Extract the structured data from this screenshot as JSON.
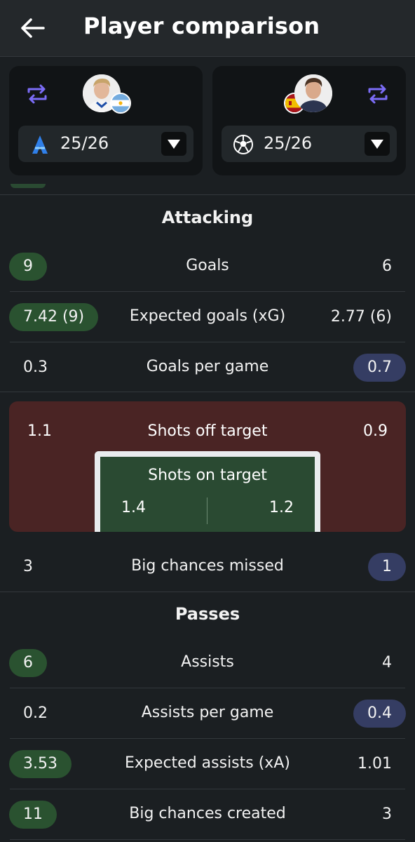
{
  "header": {
    "title": "Player comparison",
    "back_icon": "arrow-left-icon"
  },
  "players": [
    {
      "side": "left",
      "nationality_flag": "argentina-flag-icon",
      "competition_icon": "serie-a-icon",
      "season": "25/26",
      "swap_icon": "swap-icon"
    },
    {
      "side": "right",
      "nationality_flag": "spain-flag-icon",
      "competition_icon": "champions-league-icon",
      "season": "25/26",
      "swap_icon": "swap-icon"
    }
  ],
  "colors": {
    "better_left": "#2a5230",
    "better_right": "#353d63",
    "accent": "#7b6cf6",
    "shots_bg": "#4a2424",
    "goal_bg": "#2a4a32"
  },
  "sections": {
    "attacking": {
      "title": "Attacking",
      "rows": [
        {
          "label": "Goals",
          "left": "9",
          "right": "6",
          "highlight": "left"
        },
        {
          "label": "Expected goals (xG)",
          "left": "7.42 (9)",
          "right": "2.77 (6)",
          "highlight": "left"
        },
        {
          "label": "Goals per game",
          "left": "0.3",
          "right": "0.7",
          "highlight": "right"
        }
      ],
      "shots": {
        "off_label": "Shots off target",
        "off_left": "1.1",
        "off_right": "0.9",
        "on_label": "Shots on target",
        "on_left": "1.4",
        "on_right": "1.2"
      },
      "big_chances_missed": {
        "label": "Big chances missed",
        "left": "3",
        "right": "1",
        "highlight": "right"
      }
    },
    "passes": {
      "title": "Passes",
      "rows": [
        {
          "label": "Assists",
          "left": "6",
          "right": "4",
          "highlight": "left"
        },
        {
          "label": "Assists per game",
          "left": "0.2",
          "right": "0.4",
          "highlight": "right"
        },
        {
          "label": "Expected assists (xA)",
          "left": "3.53",
          "right": "1.01",
          "highlight": "left"
        },
        {
          "label": "Big chances created",
          "left": "11",
          "right": "3",
          "highlight": "left"
        }
      ]
    }
  }
}
